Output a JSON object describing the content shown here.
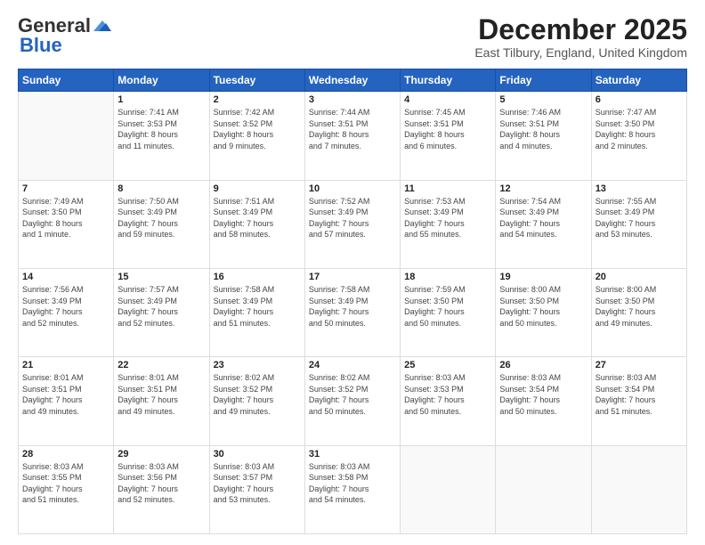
{
  "header": {
    "logo_general": "General",
    "logo_blue": "Blue",
    "month_title": "December 2025",
    "location": "East Tilbury, England, United Kingdom"
  },
  "weekdays": [
    "Sunday",
    "Monday",
    "Tuesday",
    "Wednesday",
    "Thursday",
    "Friday",
    "Saturday"
  ],
  "weeks": [
    [
      {
        "day": "",
        "info": ""
      },
      {
        "day": "1",
        "info": "Sunrise: 7:41 AM\nSunset: 3:53 PM\nDaylight: 8 hours\nand 11 minutes."
      },
      {
        "day": "2",
        "info": "Sunrise: 7:42 AM\nSunset: 3:52 PM\nDaylight: 8 hours\nand 9 minutes."
      },
      {
        "day": "3",
        "info": "Sunrise: 7:44 AM\nSunset: 3:51 PM\nDaylight: 8 hours\nand 7 minutes."
      },
      {
        "day": "4",
        "info": "Sunrise: 7:45 AM\nSunset: 3:51 PM\nDaylight: 8 hours\nand 6 minutes."
      },
      {
        "day": "5",
        "info": "Sunrise: 7:46 AM\nSunset: 3:51 PM\nDaylight: 8 hours\nand 4 minutes."
      },
      {
        "day": "6",
        "info": "Sunrise: 7:47 AM\nSunset: 3:50 PM\nDaylight: 8 hours\nand 2 minutes."
      }
    ],
    [
      {
        "day": "7",
        "info": "Sunrise: 7:49 AM\nSunset: 3:50 PM\nDaylight: 8 hours\nand 1 minute."
      },
      {
        "day": "8",
        "info": "Sunrise: 7:50 AM\nSunset: 3:49 PM\nDaylight: 7 hours\nand 59 minutes."
      },
      {
        "day": "9",
        "info": "Sunrise: 7:51 AM\nSunset: 3:49 PM\nDaylight: 7 hours\nand 58 minutes."
      },
      {
        "day": "10",
        "info": "Sunrise: 7:52 AM\nSunset: 3:49 PM\nDaylight: 7 hours\nand 57 minutes."
      },
      {
        "day": "11",
        "info": "Sunrise: 7:53 AM\nSunset: 3:49 PM\nDaylight: 7 hours\nand 55 minutes."
      },
      {
        "day": "12",
        "info": "Sunrise: 7:54 AM\nSunset: 3:49 PM\nDaylight: 7 hours\nand 54 minutes."
      },
      {
        "day": "13",
        "info": "Sunrise: 7:55 AM\nSunset: 3:49 PM\nDaylight: 7 hours\nand 53 minutes."
      }
    ],
    [
      {
        "day": "14",
        "info": "Sunrise: 7:56 AM\nSunset: 3:49 PM\nDaylight: 7 hours\nand 52 minutes."
      },
      {
        "day": "15",
        "info": "Sunrise: 7:57 AM\nSunset: 3:49 PM\nDaylight: 7 hours\nand 52 minutes."
      },
      {
        "day": "16",
        "info": "Sunrise: 7:58 AM\nSunset: 3:49 PM\nDaylight: 7 hours\nand 51 minutes."
      },
      {
        "day": "17",
        "info": "Sunrise: 7:58 AM\nSunset: 3:49 PM\nDaylight: 7 hours\nand 50 minutes."
      },
      {
        "day": "18",
        "info": "Sunrise: 7:59 AM\nSunset: 3:50 PM\nDaylight: 7 hours\nand 50 minutes."
      },
      {
        "day": "19",
        "info": "Sunrise: 8:00 AM\nSunset: 3:50 PM\nDaylight: 7 hours\nand 50 minutes."
      },
      {
        "day": "20",
        "info": "Sunrise: 8:00 AM\nSunset: 3:50 PM\nDaylight: 7 hours\nand 49 minutes."
      }
    ],
    [
      {
        "day": "21",
        "info": "Sunrise: 8:01 AM\nSunset: 3:51 PM\nDaylight: 7 hours\nand 49 minutes."
      },
      {
        "day": "22",
        "info": "Sunrise: 8:01 AM\nSunset: 3:51 PM\nDaylight: 7 hours\nand 49 minutes."
      },
      {
        "day": "23",
        "info": "Sunrise: 8:02 AM\nSunset: 3:52 PM\nDaylight: 7 hours\nand 49 minutes."
      },
      {
        "day": "24",
        "info": "Sunrise: 8:02 AM\nSunset: 3:52 PM\nDaylight: 7 hours\nand 50 minutes."
      },
      {
        "day": "25",
        "info": "Sunrise: 8:03 AM\nSunset: 3:53 PM\nDaylight: 7 hours\nand 50 minutes."
      },
      {
        "day": "26",
        "info": "Sunrise: 8:03 AM\nSunset: 3:54 PM\nDaylight: 7 hours\nand 50 minutes."
      },
      {
        "day": "27",
        "info": "Sunrise: 8:03 AM\nSunset: 3:54 PM\nDaylight: 7 hours\nand 51 minutes."
      }
    ],
    [
      {
        "day": "28",
        "info": "Sunrise: 8:03 AM\nSunset: 3:55 PM\nDaylight: 7 hours\nand 51 minutes."
      },
      {
        "day": "29",
        "info": "Sunrise: 8:03 AM\nSunset: 3:56 PM\nDaylight: 7 hours\nand 52 minutes."
      },
      {
        "day": "30",
        "info": "Sunrise: 8:03 AM\nSunset: 3:57 PM\nDaylight: 7 hours\nand 53 minutes."
      },
      {
        "day": "31",
        "info": "Sunrise: 8:03 AM\nSunset: 3:58 PM\nDaylight: 7 hours\nand 54 minutes."
      },
      {
        "day": "",
        "info": ""
      },
      {
        "day": "",
        "info": ""
      },
      {
        "day": "",
        "info": ""
      }
    ]
  ]
}
